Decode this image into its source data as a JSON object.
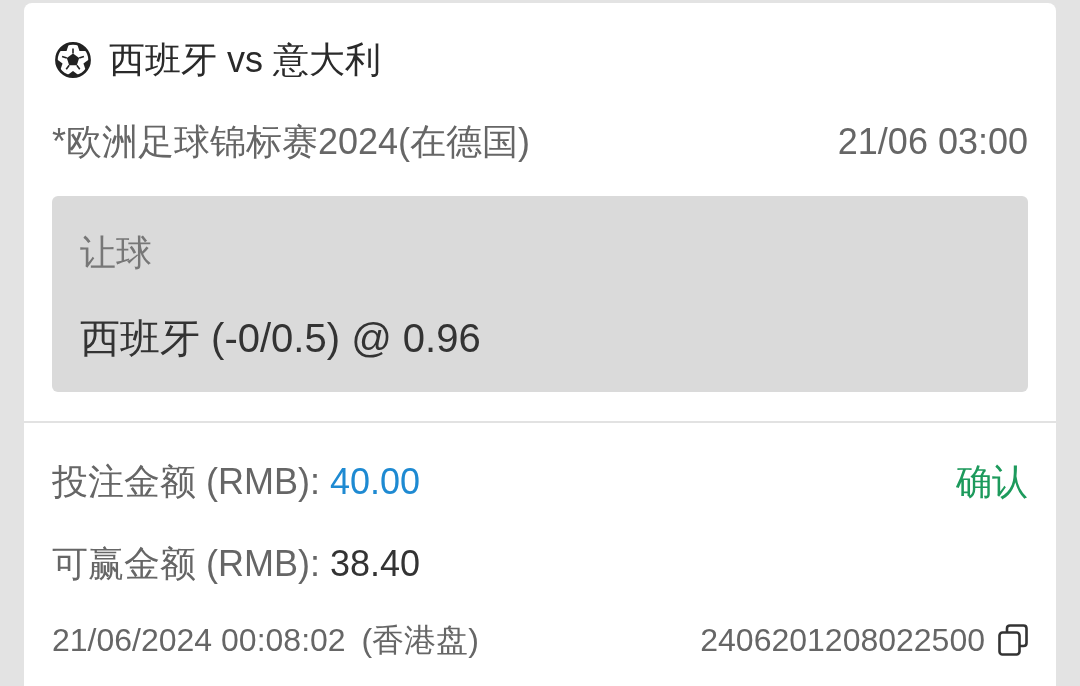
{
  "match": {
    "title": "西班牙 vs 意大利",
    "league": "*欧洲足球锦标赛2024(在德国)",
    "kickoff": "21/06 03:00"
  },
  "selection": {
    "market": "让球",
    "pick": "西班牙 (-0/0.5) @ 0.96"
  },
  "stake": {
    "label": "投注金额 (RMB):",
    "value": "40.00"
  },
  "confirm_button": "确认",
  "payout": {
    "label": "可赢金额 (RMB):",
    "value": "38.40"
  },
  "footer": {
    "timestamp": "21/06/2024 00:08:02",
    "odds_type": "(香港盘)",
    "ticket_id": "2406201208022500"
  }
}
